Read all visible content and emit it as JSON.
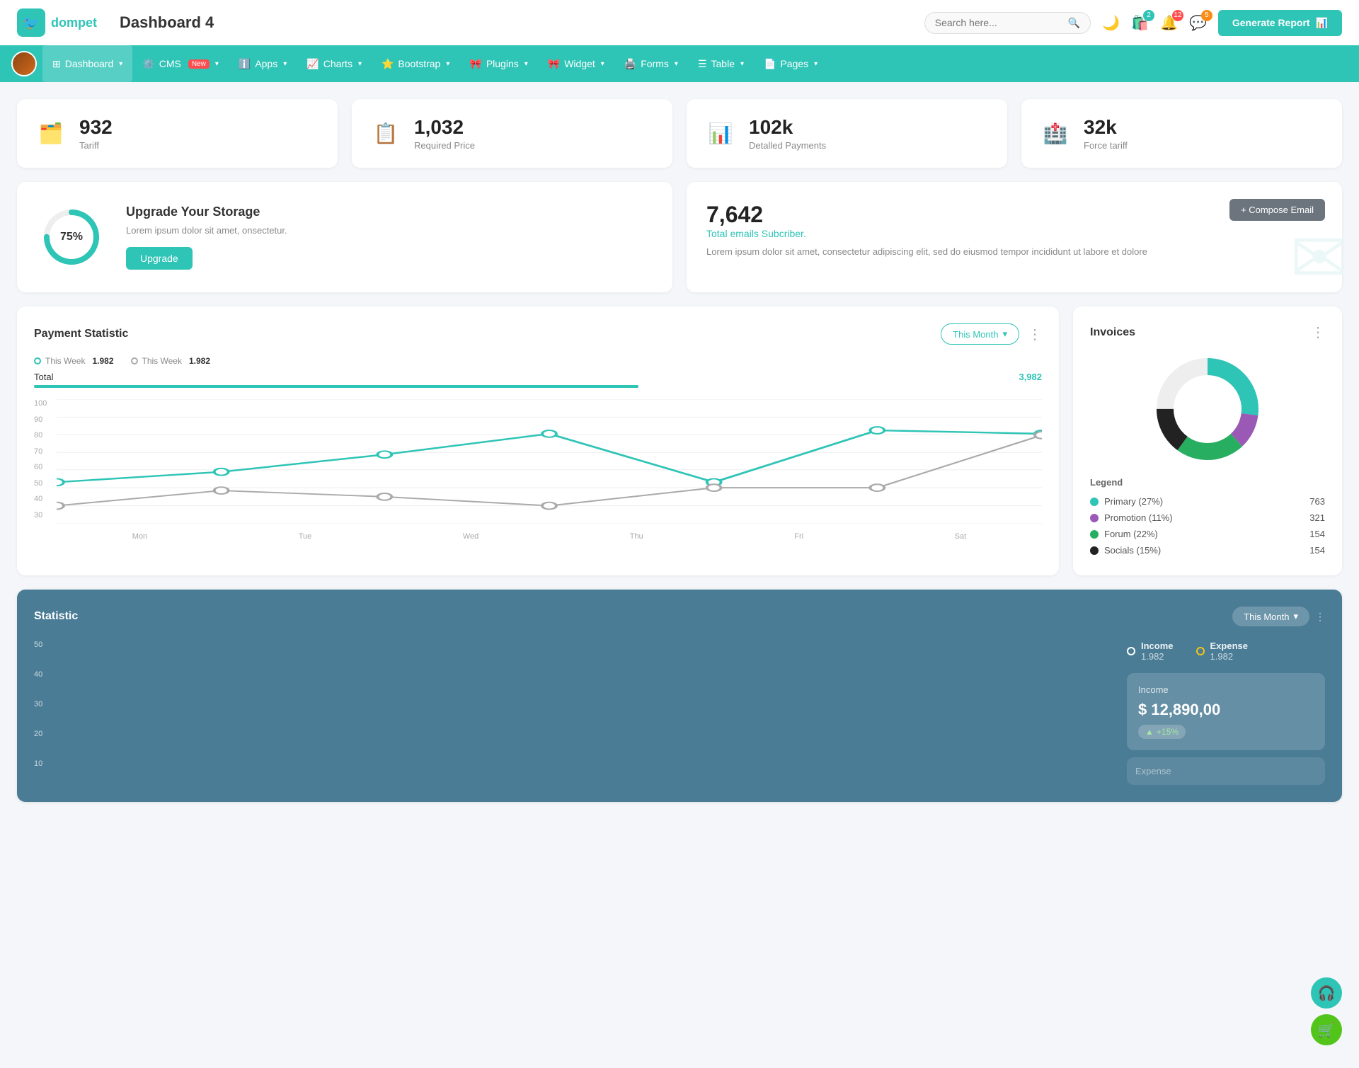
{
  "header": {
    "logo_text": "dompet",
    "page_title": "Dashboard 4",
    "search_placeholder": "Search here...",
    "generate_btn": "Generate Report",
    "icons": {
      "cart_badge": "2",
      "bell_badge": "12",
      "chat_badge": "5"
    }
  },
  "nav": {
    "items": [
      {
        "label": "Dashboard",
        "active": true,
        "has_dropdown": true
      },
      {
        "label": "CMS",
        "active": false,
        "has_new": true,
        "has_dropdown": true
      },
      {
        "label": "Apps",
        "active": false,
        "has_dropdown": true
      },
      {
        "label": "Charts",
        "active": false,
        "has_dropdown": true
      },
      {
        "label": "Bootstrap",
        "active": false,
        "has_dropdown": true
      },
      {
        "label": "Plugins",
        "active": false,
        "has_dropdown": true
      },
      {
        "label": "Widget",
        "active": false,
        "has_dropdown": true
      },
      {
        "label": "Forms",
        "active": false,
        "has_dropdown": true
      },
      {
        "label": "Table",
        "active": false,
        "has_dropdown": true
      },
      {
        "label": "Pages",
        "active": false,
        "has_dropdown": true
      }
    ]
  },
  "stat_cards": [
    {
      "value": "932",
      "label": "Tariff",
      "icon": "🗂️",
      "icon_color": "#2ec4b6"
    },
    {
      "value": "1,032",
      "label": "Required Price",
      "icon": "📋",
      "icon_color": "#f5222d"
    },
    {
      "value": "102k",
      "label": "Detalled Payments",
      "icon": "📊",
      "icon_color": "#722ed1"
    },
    {
      "value": "32k",
      "label": "Force tariff",
      "icon": "🏥",
      "icon_color": "#eb2f96"
    }
  ],
  "storage": {
    "percent": 75,
    "title": "Upgrade Your Storage",
    "description": "Lorem ipsum dolor sit amet, onsectetur.",
    "btn_label": "Upgrade"
  },
  "email": {
    "count": "7,642",
    "subtitle": "Total emails Subcriber.",
    "description": "Lorem ipsum dolor sit amet, consectetur adipiscing elit, sed do eiusmod tempor incididunt ut labore et dolore",
    "compose_btn": "+ Compose Email"
  },
  "payment": {
    "title": "Payment Statistic",
    "month_btn": "This Month",
    "legends": [
      {
        "label": "This Week",
        "value": "1.982",
        "color": "#2ec4b6"
      },
      {
        "label": "This Week",
        "value": "1.982",
        "color": "#aaa"
      }
    ],
    "total_label": "Total",
    "total_value": "3,982",
    "x_labels": [
      "Mon",
      "Tue",
      "Wed",
      "Thu",
      "Fri",
      "Sat"
    ],
    "y_labels": [
      "100",
      "90",
      "80",
      "70",
      "60",
      "50",
      "40",
      "30"
    ]
  },
  "invoices": {
    "title": "Invoices",
    "legend": [
      {
        "label": "Primary (27%)",
        "value": "763",
        "color": "#2ec4b6"
      },
      {
        "label": "Promotion (11%)",
        "value": "321",
        "color": "#9b59b6"
      },
      {
        "label": "Forum (22%)",
        "value": "154",
        "color": "#27ae60"
      },
      {
        "label": "Socials (15%)",
        "value": "154",
        "color": "#222"
      }
    ]
  },
  "statistic": {
    "title": "Statistic",
    "month_btn": "This Month",
    "y_labels": [
      "50",
      "40",
      "30",
      "20",
      "10"
    ],
    "legend": [
      {
        "label": "Income",
        "value": "1.982",
        "color": "white"
      },
      {
        "label": "Expense",
        "value": "1.982",
        "color": "#f5c518"
      }
    ],
    "income_box": {
      "title": "Income",
      "amount": "$ 12,890,00",
      "badge": "+15%"
    }
  }
}
